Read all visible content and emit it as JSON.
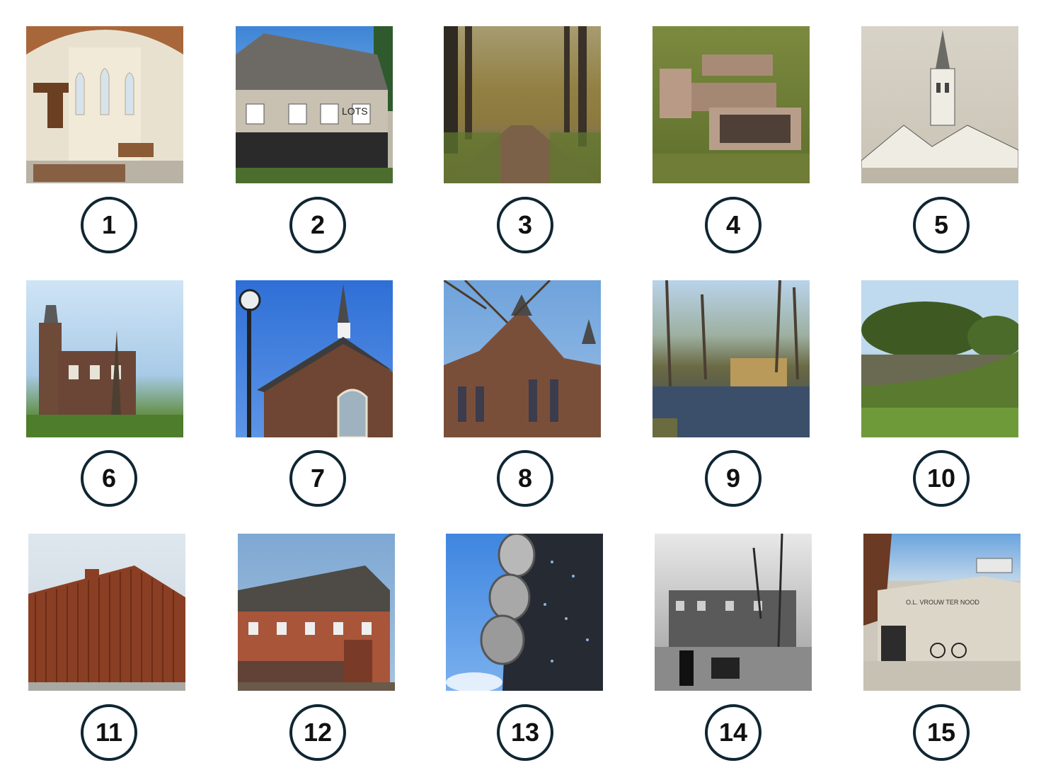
{
  "tiles": [
    {
      "number": "1",
      "image": "church-interior-photo"
    },
    {
      "number": "2",
      "image": "restaurant-building-photo"
    },
    {
      "number": "3",
      "image": "tree-lined-path-photo"
    },
    {
      "number": "4",
      "image": "aerial-ruins-photo"
    },
    {
      "number": "5",
      "image": "church-tower-drawing"
    },
    {
      "number": "6",
      "image": "town-hall-photo"
    },
    {
      "number": "7",
      "image": "church-steeple-photo"
    },
    {
      "number": "8",
      "image": "gothic-church-photo"
    },
    {
      "number": "9",
      "image": "pond-park-photo"
    },
    {
      "number": "10",
      "image": "fortress-wall-photo"
    },
    {
      "number": "11",
      "image": "slatted-pavilion-photo"
    },
    {
      "number": "12",
      "image": "brick-building-photo"
    },
    {
      "number": "13",
      "image": "metal-facade-photo"
    },
    {
      "number": "14",
      "image": "historic-street-photo"
    },
    {
      "number": "15",
      "image": "modern-church-photo"
    }
  ],
  "signs": {
    "restaurant": "LOTS",
    "church15": "O.L. VROUW TER NOOD"
  },
  "colors": {
    "badge_border": "#0f2633",
    "badge_text": "#111111",
    "background": "#ffffff"
  }
}
